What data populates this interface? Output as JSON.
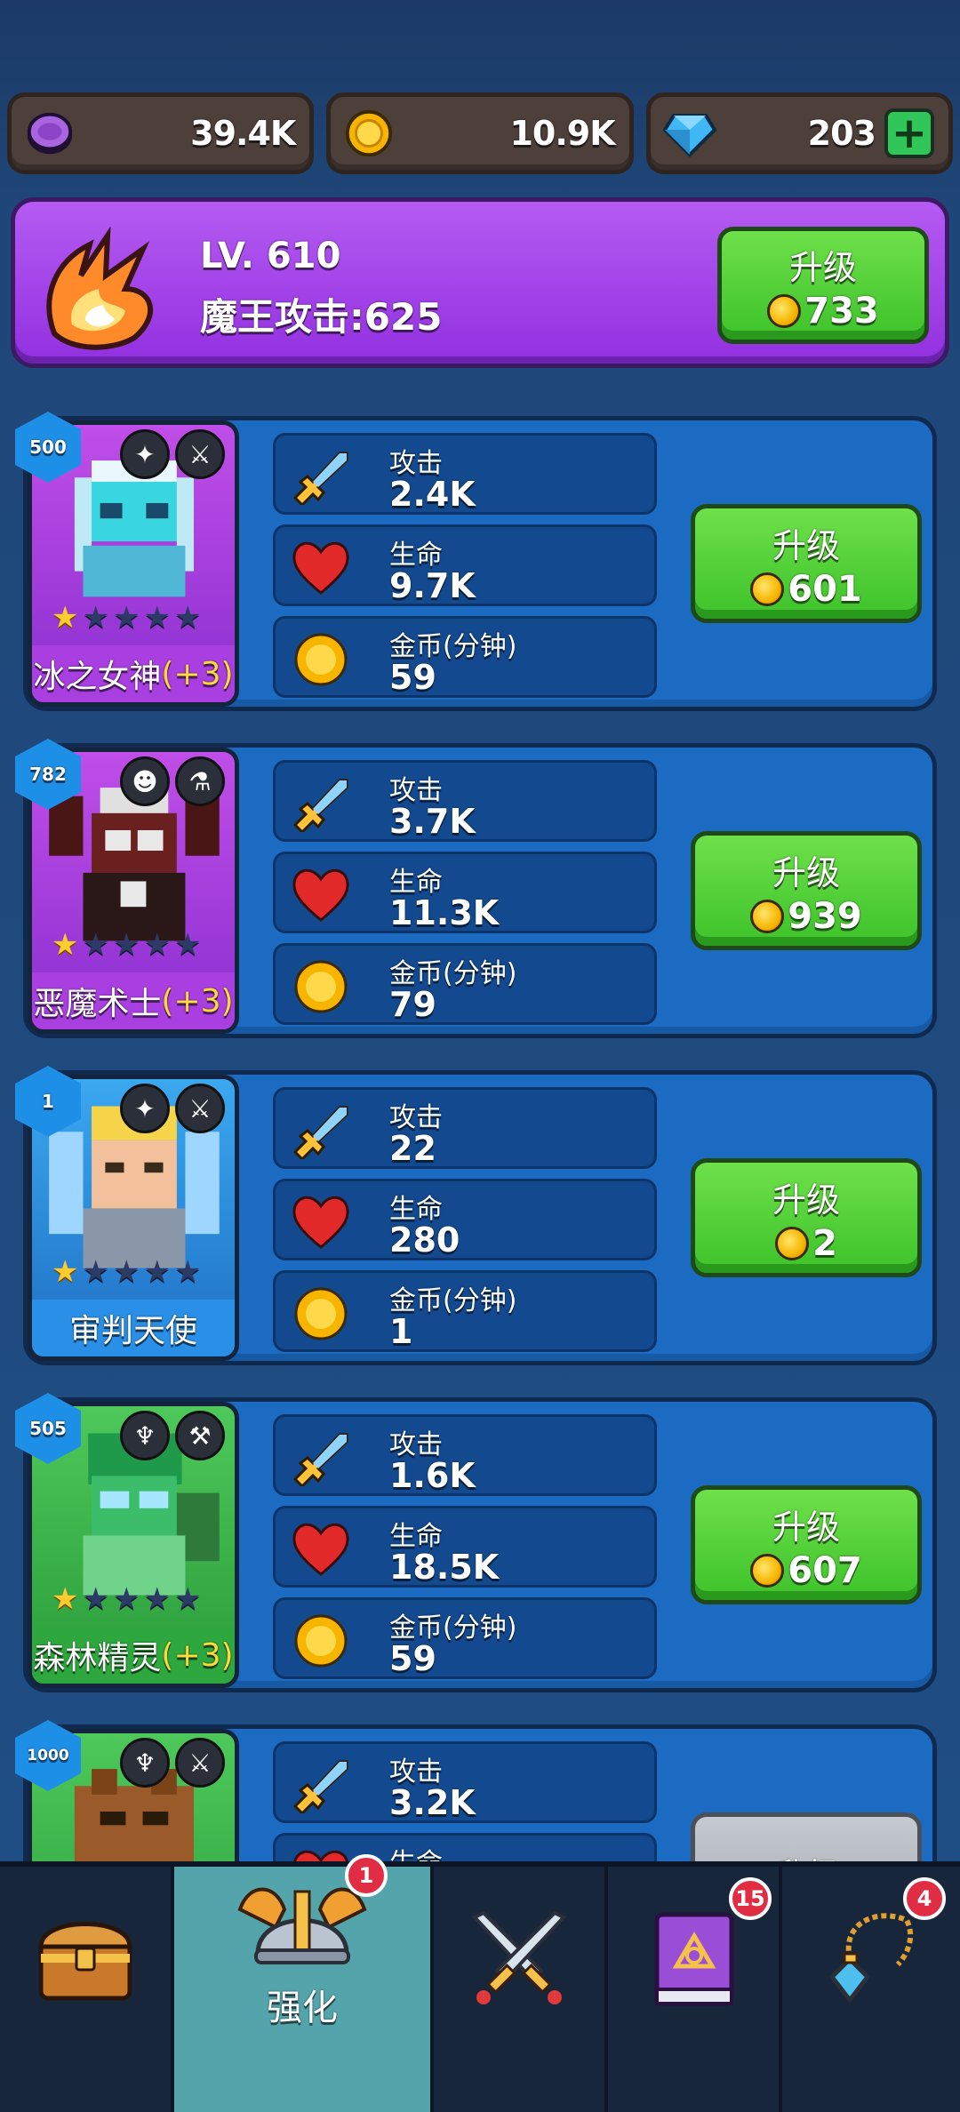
{
  "currencies": [
    {
      "name": "purple-token",
      "value": "39.4K",
      "color": "#9b59d0"
    },
    {
      "name": "gold-coin",
      "value": "10.9K",
      "color": "#f7b500"
    },
    {
      "name": "diamond",
      "value": "203",
      "color": "#3fb7f5",
      "has_add": true,
      "add_label": "+"
    }
  ],
  "boss": {
    "level": "LV. 610",
    "attack": "魔王攻击:625",
    "upgrade_label": "升级",
    "upgrade_cost": "733"
  },
  "stat_labels": {
    "attack": "攻击",
    "hp": "生命",
    "gold": "金币(分钟)"
  },
  "heroes": [
    {
      "level": "500",
      "name": "冰之女神",
      "bonus": "(+3)",
      "stars": 1,
      "attack": "2.4K",
      "hp": "9.7K",
      "gold": "59",
      "upgrade_label": "升级",
      "upgrade_cost": "601",
      "theme": "purple"
    },
    {
      "level": "782",
      "name": "恶魔术士",
      "bonus": "(+3)",
      "stars": 1,
      "attack": "3.7K",
      "hp": "11.3K",
      "gold": "79",
      "upgrade_label": "升级",
      "upgrade_cost": "939",
      "theme": "purple"
    },
    {
      "level": "1",
      "name": "审判天使",
      "bonus": "",
      "stars": 1,
      "attack": "22",
      "hp": "280",
      "gold": "1",
      "upgrade_label": "升级",
      "upgrade_cost": "2",
      "theme": "blue"
    },
    {
      "level": "505",
      "name": "森林精灵",
      "bonus": "(+3)",
      "stars": 1,
      "attack": "1.6K",
      "hp": "18.5K",
      "gold": "59",
      "upgrade_label": "升级",
      "upgrade_cost": "607",
      "theme": "green"
    },
    {
      "level": "1000",
      "name": "",
      "bonus": "",
      "stars": 0,
      "attack": "3.2K",
      "hp": "",
      "gold": "",
      "upgrade_label": "升级",
      "upgrade_cost": "",
      "theme": "green"
    }
  ],
  "nav": [
    {
      "name": "treasure-chest",
      "label": "",
      "badge": ""
    },
    {
      "name": "strengthen",
      "label": "强化",
      "badge": "1",
      "active": true
    },
    {
      "name": "battle",
      "label": "",
      "badge": ""
    },
    {
      "name": "spellbook",
      "label": "",
      "badge": "15"
    },
    {
      "name": "amulet",
      "label": "",
      "badge": "4"
    }
  ],
  "colors": {
    "accent_green": "#3dc22a",
    "boss_purple": "#9230e0",
    "card_blue": "#1c6bc2",
    "nav_active": "#54a4ab"
  }
}
